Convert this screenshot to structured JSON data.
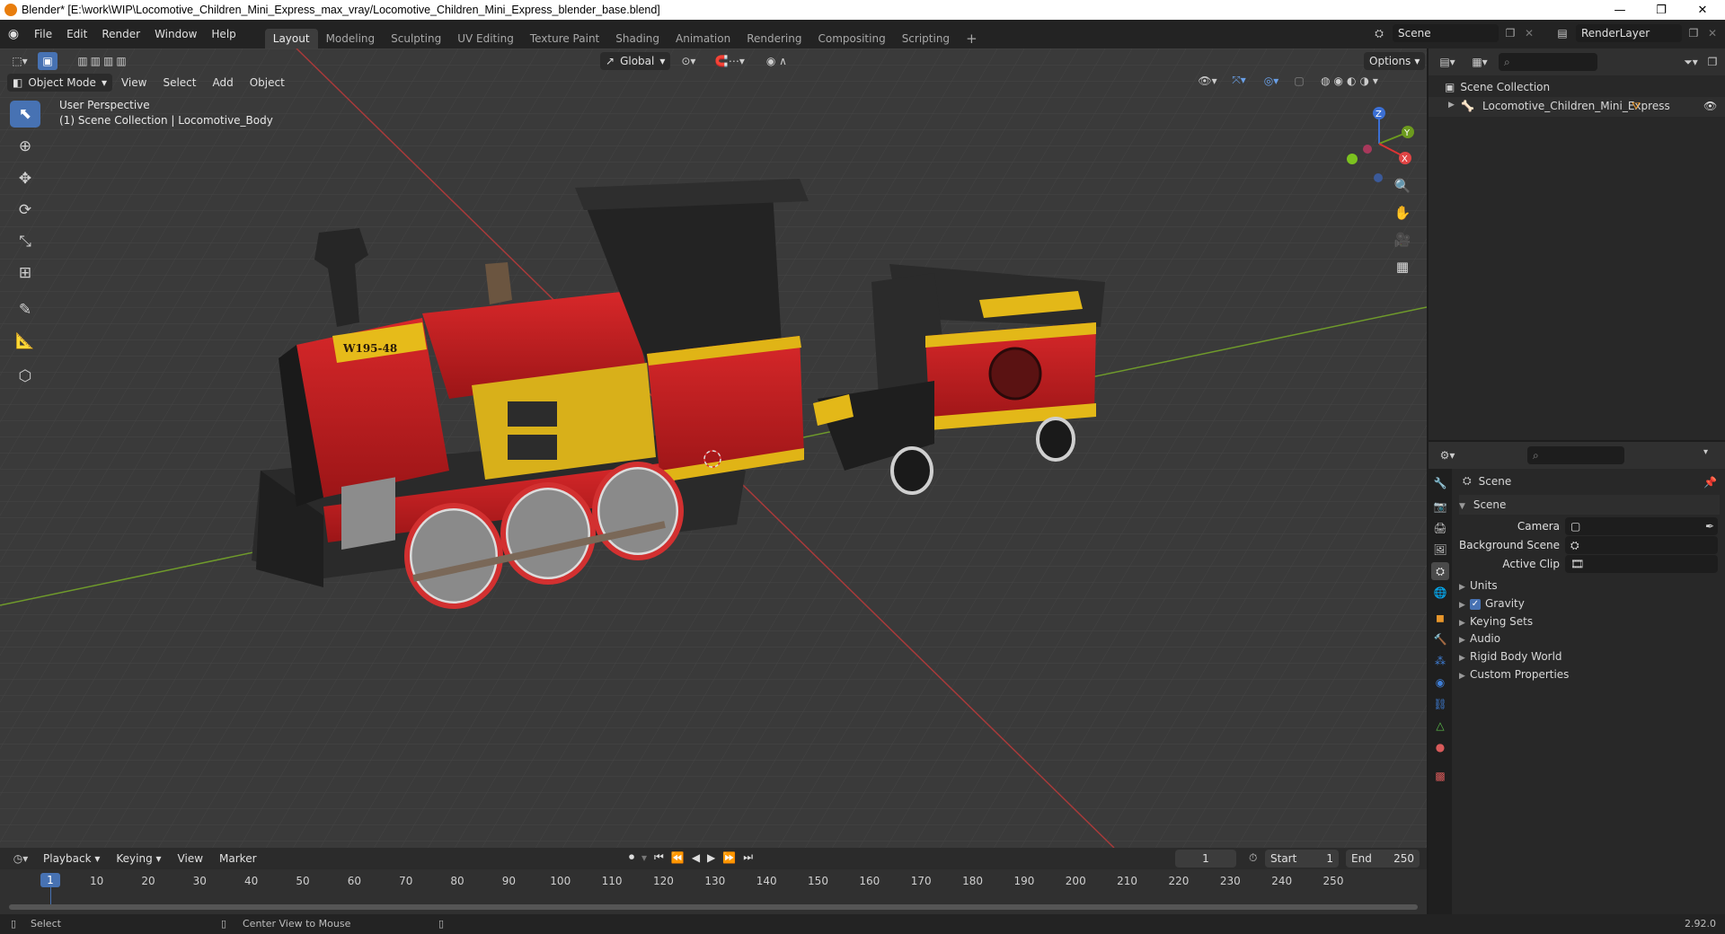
{
  "window": {
    "title": "Blender* [E:\\work\\WIP\\Locomotive_Children_Mini_Express_max_vray/Locomotive_Children_Mini_Express_blender_base.blend]",
    "minimize": "—",
    "restore": "❐",
    "close": "✕"
  },
  "menubar": {
    "items": [
      "File",
      "Edit",
      "Render",
      "Window",
      "Help"
    ],
    "workspaces": [
      "Layout",
      "Modeling",
      "Sculpting",
      "UV Editing",
      "Texture Paint",
      "Shading",
      "Animation",
      "Rendering",
      "Compositing",
      "Scripting"
    ],
    "active_workspace": "Layout",
    "add_tab": "+",
    "scene": "Scene",
    "render_layer": "RenderLayer"
  },
  "viewport": {
    "mode": "Object Mode",
    "menus": [
      "View",
      "Select",
      "Add",
      "Object"
    ],
    "transform_orientation": "Global",
    "options": "Options",
    "perspective_label": "User Perspective",
    "collection_label": "(1) Scene Collection | Locomotive_Body",
    "train_label": "W195-48",
    "gizmo": {
      "z": "Z",
      "y": "Y",
      "x": "X"
    }
  },
  "outliner": {
    "root": "Scene Collection",
    "items": [
      "Locomotive_Children_Mini_Express"
    ]
  },
  "properties": {
    "context": "Scene",
    "panel": "Scene",
    "fields": [
      {
        "label": "Camera",
        "value": ""
      },
      {
        "label": "Background Scene",
        "value": ""
      },
      {
        "label": "Active Clip",
        "value": ""
      }
    ],
    "subpanels": [
      "Units",
      "Gravity",
      "Keying Sets",
      "Audio",
      "Rigid Body World",
      "Custom Properties"
    ],
    "gravity_checked": true
  },
  "timeline": {
    "menus": [
      "Playback",
      "Keying",
      "View",
      "Marker"
    ],
    "current_frame": "1",
    "start_label": "Start",
    "start": "1",
    "end_label": "End",
    "end": "250",
    "ticks": [
      "1",
      "10",
      "20",
      "30",
      "40",
      "50",
      "60",
      "70",
      "80",
      "90",
      "100",
      "110",
      "120",
      "130",
      "140",
      "150",
      "160",
      "170",
      "180",
      "190",
      "200",
      "210",
      "220",
      "230",
      "240",
      "250"
    ]
  },
  "statusbar": {
    "left": "Select",
    "middle": "Center View to Mouse",
    "version": "2.92.0"
  }
}
